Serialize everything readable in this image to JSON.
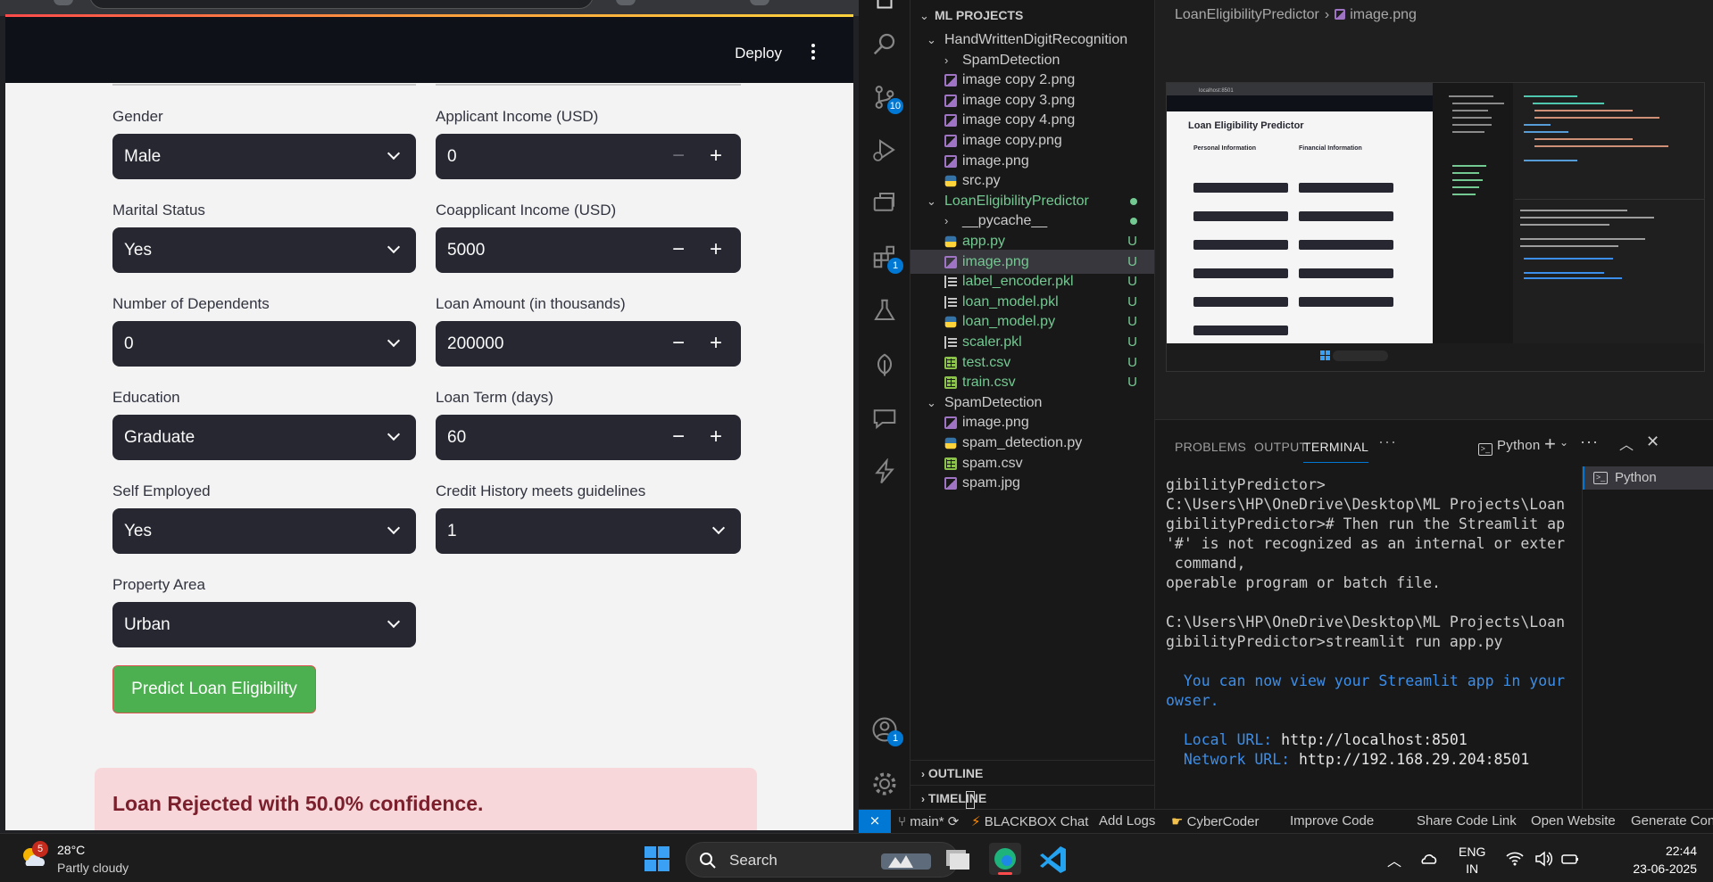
{
  "streamlit": {
    "deploy_label": "Deploy",
    "left_fields": [
      {
        "label": "Gender",
        "value": "Male"
      },
      {
        "label": "Marital Status",
        "value": "Yes"
      },
      {
        "label": "Number of Dependents",
        "value": "0"
      },
      {
        "label": "Education",
        "value": "Graduate"
      },
      {
        "label": "Self Employed",
        "value": "Yes"
      },
      {
        "label": "Property Area",
        "value": "Urban"
      }
    ],
    "right_fields": [
      {
        "label": "Applicant Income (USD)",
        "value": "0"
      },
      {
        "label": "Coapplicant Income (USD)",
        "value": "5000"
      },
      {
        "label": "Loan Amount (in thousands)",
        "value": "200000"
      },
      {
        "label": "Loan Term (days)",
        "value": "60"
      },
      {
        "label": "Credit History meets guidelines",
        "value": "1"
      }
    ],
    "minus_symbol": "−",
    "plus_symbol": "+",
    "predict_button": "Predict Loan Eligibility",
    "result": "Loan Rejected with 50.0% confidence.",
    "colors": {
      "button": "#4caf50",
      "result_bg": "#f8d7da",
      "result_text": "#7a1f2b",
      "input_bg": "#262730"
    }
  },
  "vscode": {
    "explorer_title": "ML PROJECTS",
    "tree": [
      {
        "name": "HandWrittenDigitRecognition",
        "type": "folder-open",
        "depth": 1
      },
      {
        "name": "SpamDetection",
        "type": "folder-closed",
        "depth": 2
      },
      {
        "name": "image copy 2.png",
        "type": "image",
        "depth": 2
      },
      {
        "name": "image copy 3.png",
        "type": "image",
        "depth": 2
      },
      {
        "name": "image copy 4.png",
        "type": "image",
        "depth": 2
      },
      {
        "name": "image copy.png",
        "type": "image",
        "depth": 2
      },
      {
        "name": "image.png",
        "type": "image",
        "depth": 2
      },
      {
        "name": "src.py",
        "type": "python",
        "depth": 2
      },
      {
        "name": "LoanEligibilityPredictor",
        "type": "folder-open",
        "depth": 1,
        "green": true,
        "status": "dot"
      },
      {
        "name": "__pycache__",
        "type": "folder-closed",
        "depth": 2,
        "status": "dot"
      },
      {
        "name": "app.py",
        "type": "python",
        "depth": 2,
        "green": true,
        "status": "U"
      },
      {
        "name": "image.png",
        "type": "image",
        "depth": 2,
        "green": true,
        "status": "U",
        "selected": true
      },
      {
        "name": "label_encoder.pkl",
        "type": "text",
        "depth": 2,
        "green": true,
        "status": "U"
      },
      {
        "name": "loan_model.pkl",
        "type": "text",
        "depth": 2,
        "green": true,
        "status": "U"
      },
      {
        "name": "loan_model.py",
        "type": "python",
        "depth": 2,
        "green": true,
        "status": "U"
      },
      {
        "name": "scaler.pkl",
        "type": "text",
        "depth": 2,
        "green": true,
        "status": "U"
      },
      {
        "name": "test.csv",
        "type": "csv",
        "depth": 2,
        "green": true,
        "status": "U"
      },
      {
        "name": "train.csv",
        "type": "csv",
        "depth": 2,
        "green": true,
        "status": "U"
      },
      {
        "name": "SpamDetection",
        "type": "folder-open",
        "depth": 1
      },
      {
        "name": "image.png",
        "type": "image",
        "depth": 2
      },
      {
        "name": "spam_detection.py",
        "type": "python",
        "depth": 2
      },
      {
        "name": "spam.csv",
        "type": "csv",
        "depth": 2
      },
      {
        "name": "spam.jpg",
        "type": "image",
        "depth": 2
      }
    ],
    "outline": "OUTLINE",
    "timeline": "TIMELINE",
    "breadcrumb": {
      "folder": "LoanEligibilityPredictor",
      "file": "image.png"
    },
    "badges": {
      "source_control": "10",
      "extensions": "1",
      "accounts": "1"
    },
    "panel_tabs": [
      "PROBLEMS",
      "OUTPUT",
      "TERMINAL"
    ],
    "terminal_profile": "Python",
    "terminal_list_item": "Python",
    "terminal_lines": [
      {
        "text": "gibilityPredictor>",
        "style": "normal"
      },
      {
        "text": "C:\\Users\\HP\\OneDrive\\Desktop\\ML Projects\\LoanEli",
        "style": "normal"
      },
      {
        "text": "gibilityPredictor># Then run the Streamlit app",
        "style": "normal"
      },
      {
        "text": "'#' is not recognized as an internal or external",
        "style": "normal"
      },
      {
        "text": " command,",
        "style": "normal"
      },
      {
        "text": "operable program or batch file.",
        "style": "normal"
      },
      {
        "text": "",
        "style": "normal"
      },
      {
        "text": "C:\\Users\\HP\\OneDrive\\Desktop\\ML Projects\\LoanEli",
        "style": "normal"
      },
      {
        "text": "gibilityPredictor>streamlit run app.py",
        "style": "normal"
      },
      {
        "text": "",
        "style": "normal"
      },
      {
        "text": "  You can now view your Streamlit app in your br",
        "style": "blue"
      },
      {
        "text": "owser.",
        "style": "blue"
      },
      {
        "text": "",
        "style": "normal"
      },
      {
        "text": "  Local URL: http://localhost:8501",
        "style": "url"
      },
      {
        "text": "  Network URL: http://192.168.29.204:8501",
        "style": "url"
      }
    ],
    "status_bar": {
      "branch": "main*",
      "items": [
        "BLACKBOX Chat",
        "Add Logs",
        "CyberCoder",
        "Improve Code",
        "Share Code Link",
        "Open Website",
        "Generate Con"
      ]
    },
    "preview": {
      "title": "Loan Eligibility Predictor",
      "personal": "Personal Information",
      "financial": "Financial Information",
      "url": "localhost:8501"
    }
  },
  "taskbar": {
    "weather_temp": "28°C",
    "weather_desc": "Partly cloudy",
    "weather_badge": "5",
    "search_label": "Search",
    "lang_1": "ENG",
    "lang_2": "IN",
    "time": "22:44",
    "date": "23-06-2025"
  }
}
